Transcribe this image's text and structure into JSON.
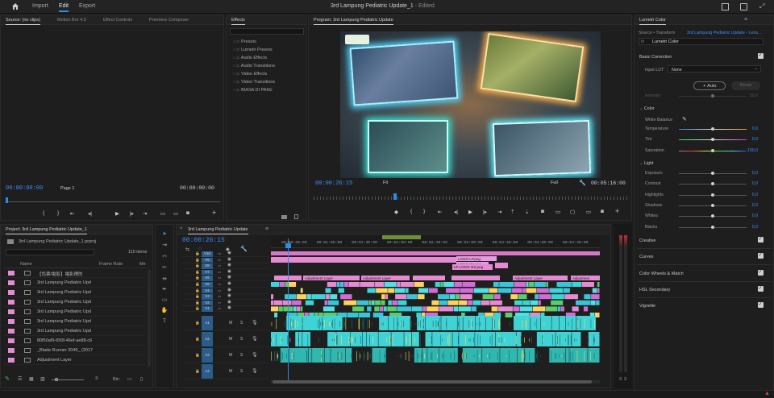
{
  "menu": {
    "home_icon": "home-icon",
    "import": "Import",
    "edit": "Edit",
    "export": "Export",
    "title": "3rd Lampung Pediatric Update_1",
    "status": " - Edited"
  },
  "source": {
    "tabs": [
      "Source: (no clips)",
      "Motion Bro 4.0",
      "Effect Controls",
      "Premiere Composer"
    ],
    "tc_left": "00:00:00:00",
    "page": "Page 1",
    "tc_right": "00:00:00:00"
  },
  "effects": {
    "tab": "Effects",
    "items": [
      "Presets",
      "Lumetri Presets",
      "Audio Effects",
      "Audio Transitions",
      "Video Effects",
      "Video Transitions",
      "BIASA DI PAKE"
    ]
  },
  "program": {
    "tab": "Program: 3rd Lampung Pediatric Update",
    "tc": "00:00:26:15",
    "fit": "Fit",
    "full": "Full",
    "duration": "00:05:16:00"
  },
  "lumetri": {
    "tab": "Lumetri Color",
    "source": "Source • Transform",
    "sequence": "3rd Lampung Pediatric Update - Lens...",
    "fx": "fx",
    "fx_name": "Lumetri Color",
    "basic": "Basic Correction",
    "input_lut": "Input LUT",
    "lut_value": "None",
    "auto": "Auto",
    "reset": "Reset",
    "intensity": "Intensity",
    "intensity_val": "50,0",
    "color": "Color",
    "white_balance": "White Balance",
    "color_sliders": [
      {
        "label": "Temperature",
        "val": "0,0",
        "pos": 0.5
      },
      {
        "label": "Tint",
        "val": "0,0",
        "pos": 0.5
      },
      {
        "label": "Saturation",
        "val": "100,0",
        "pos": 0.5
      }
    ],
    "light": "Light",
    "light_sliders": [
      {
        "label": "Exposure",
        "val": "0,0",
        "pos": 0.5
      },
      {
        "label": "Contrast",
        "val": "0,0",
        "pos": 0.5
      },
      {
        "label": "Highlights",
        "val": "0,0",
        "pos": 0.5
      },
      {
        "label": "Shadows",
        "val": "0,0",
        "pos": 0.5
      },
      {
        "label": "Whites",
        "val": "0,0",
        "pos": 0.5
      },
      {
        "label": "Blacks",
        "val": "0,0",
        "pos": 0.5
      }
    ],
    "sections": [
      "Creative",
      "Curves",
      "Color Wheels & Match",
      "HSL Secondary",
      "Vignette"
    ]
  },
  "project": {
    "tab": "Project: 3rd Lampung Pediatric Update_1",
    "file": "3rd Lampung Pediatric Update_1.prproj",
    "count": "110 items",
    "col_name": "Name",
    "col_rate": "Frame Rate",
    "col_media": "Me",
    "rows": [
      "【色票/電影】電影裡的",
      "3rd Lampung Pediatric Upd",
      "3rd Lampung Pediatric Upd",
      "3rd Lampung Pediatric Upd",
      "3rd Lampung Pediatric Upd",
      "3rd Lampung Pediatric Upd",
      "3rd Lampung Pediatric Upd",
      "80f50af9-650f-46ef-ae88-c6",
      "_Blade Runner 2049_ (2017",
      "Adjustment Layer"
    ],
    "bin": "Bin"
  },
  "timeline": {
    "tab": "3rd Lampung Pediatric Update",
    "tc": "00:00:26:15",
    "ruler": [
      "00:00:30:00",
      "00:01:00:00",
      "00:01:30:00",
      "00:02:00:00",
      "00:02:30:00",
      "00:03:00:00",
      "00:03:30:00",
      "00:04:00:00",
      "00:04:30:00"
    ],
    "video_tracks": [
      "V10",
      "V9",
      "V8",
      "V7",
      "V6",
      "V5",
      "V4",
      "V3",
      "V2",
      "V1"
    ],
    "audio_tracks": [
      "A1",
      "A2",
      "A3",
      "A4"
    ],
    "clip_labels": {
      "logo_lp": "LOGO LP.png",
      "logo_idi": "LOGO IDI.png",
      "logo_3rd": "LP LOGO 3rd.png",
      "adj": "Adjustment Layer",
      "adj_short": "Adjustmen"
    }
  },
  "meter": {
    "s": "S",
    "s2": "S"
  }
}
